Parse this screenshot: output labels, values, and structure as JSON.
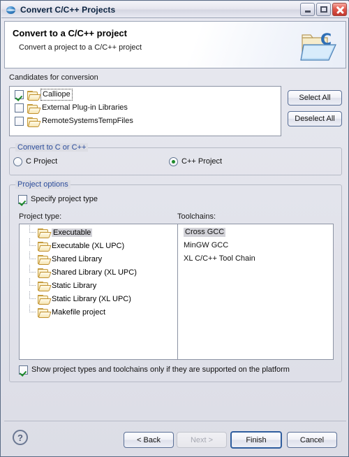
{
  "window": {
    "title": "Convert C/C++ Projects",
    "icon": "eclipse-sphere-icon",
    "controls": {
      "minimize": "minimize-button",
      "maximize": "maximize-button",
      "close": "close-button"
    }
  },
  "banner": {
    "title": "Convert to a C/C++ project",
    "subtitle": "Convert a project to a C/C++ project",
    "icon": "c-project-folder-icon"
  },
  "candidates": {
    "label": "Candidates for conversion",
    "items": [
      {
        "label": "Calliope",
        "checked": true,
        "focused": true
      },
      {
        "label": "External Plug-in Libraries",
        "checked": false,
        "focused": false
      },
      {
        "label": "RemoteSystemsTempFiles",
        "checked": false,
        "focused": false
      }
    ],
    "select_all_label": "Select All",
    "deselect_all_label": "Deselect All"
  },
  "convert_group": {
    "title": "Convert to C or C++",
    "options": [
      {
        "label": "C Project",
        "selected": false
      },
      {
        "label": "C++ Project",
        "selected": true
      }
    ]
  },
  "project_options": {
    "title": "Project options",
    "specify_label": "Specify project type",
    "specify_checked": true,
    "project_type_label": "Project type:",
    "toolchains_label": "Toolchains:",
    "project_types": [
      {
        "label": "Executable",
        "selected": true
      },
      {
        "label": "Executable (XL UPC)",
        "selected": false
      },
      {
        "label": "Shared Library",
        "selected": false
      },
      {
        "label": "Shared Library (XL UPC)",
        "selected": false
      },
      {
        "label": "Static Library",
        "selected": false
      },
      {
        "label": "Static Library (XL UPC)",
        "selected": false
      },
      {
        "label": "Makefile project",
        "selected": false
      }
    ],
    "toolchains": [
      {
        "label": "Cross GCC",
        "selected": true
      },
      {
        "label": "MinGW GCC",
        "selected": false
      },
      {
        "label": "XL C/C++ Tool Chain",
        "selected": false
      }
    ],
    "show_supported_label": "Show project types and toolchains only if they are supported on the platform",
    "show_supported_checked": true
  },
  "footer": {
    "help_icon": "help-question-icon",
    "back_label": "< Back",
    "next_label": "Next >",
    "next_disabled": true,
    "finish_label": "Finish",
    "cancel_label": "Cancel"
  },
  "colors": {
    "dialog_bg": "#d9d9de",
    "group_title": "#2b4c9b",
    "accent_check": "#1d8a29",
    "default_button_border": "#2f5d9e"
  }
}
